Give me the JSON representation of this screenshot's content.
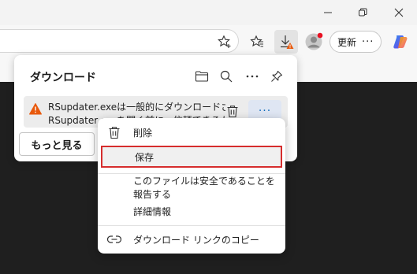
{
  "window": {
    "minimize_glyph": "─",
    "restore_glyph": "❐",
    "close_glyph": "✕"
  },
  "toolbar": {
    "update_label": "更新",
    "update_more": "···",
    "colors": {
      "download_badge": "#e8590c",
      "profile_badge": "#e81123"
    }
  },
  "downloads_panel": {
    "title": "ダウンロード",
    "item": {
      "line1": "RSupdater.exeは一般的にダウンロードされてい",
      "line2": "RSupdater.exeを開く前に、信頼できるかを確",
      "more_glyph": "···",
      "warning_icon": "warning-icon"
    },
    "show_more_label": "もっと見る"
  },
  "context_menu": {
    "items": [
      {
        "label": "削除",
        "icon": "trash-icon"
      },
      {
        "label": "保存",
        "icon": ""
      },
      {
        "label": "このファイルは安全であることを報告する",
        "icon": ""
      },
      {
        "label": "詳細情報",
        "icon": ""
      },
      {
        "label": "ダウンロード リンクのコピー",
        "icon": "link-icon"
      }
    ],
    "selected_index": 1,
    "highlight_color": "#d62d2d"
  }
}
